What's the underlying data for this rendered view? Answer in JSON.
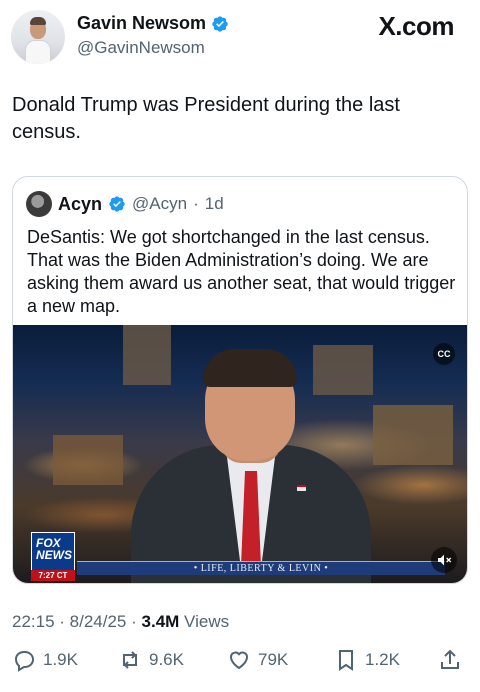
{
  "author": {
    "name": "Gavin Newsom",
    "handle": "@GavinNewsom",
    "verified_icon": "verified-badge-icon"
  },
  "site_label": "X.com",
  "tweet": {
    "text": "Donald Trump was President during the last census."
  },
  "quoted": {
    "name": "Acyn",
    "handle": "@Acyn",
    "separator": "·",
    "age": "1d",
    "text": "DeSantis: We got shortchanged in the last census. That was the Biden Administration’s doing. We are asking them award us another seat, that would trigger a new map.",
    "video": {
      "cc_label": "CC",
      "network_logo": "FOX\nNEWS",
      "time": "7:27 CT",
      "ticker": "• LIFE, LIBERTY & LEVIN •"
    }
  },
  "meta": {
    "time": "22:15",
    "date": "8/24/25",
    "views_count": "3.4M",
    "views_label": " Views"
  },
  "actions": {
    "replies": "1.9K",
    "reposts": "9.6K",
    "likes": "79K",
    "bookmarks": "1.2K"
  },
  "colors": {
    "verified_blue": "#1d9bf0",
    "text_primary": "#0f1419",
    "text_secondary": "#536471",
    "border": "#cfd9de"
  }
}
